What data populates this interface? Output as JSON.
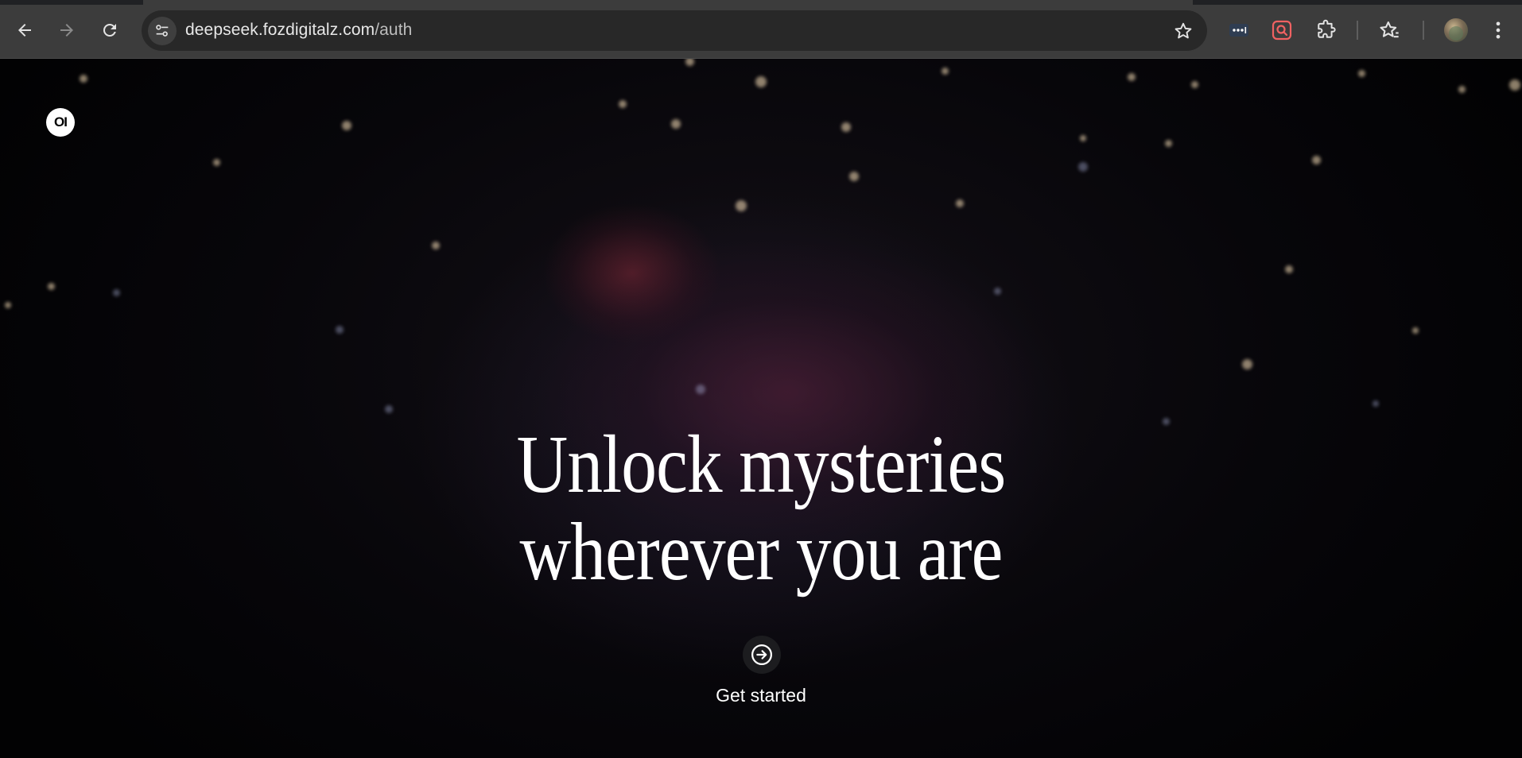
{
  "browser": {
    "url_host": "deepseek.fozdigitalz.com",
    "url_path": "/auth",
    "back_icon": "arrow-left-icon",
    "forward_icon": "arrow-right-icon",
    "reload_icon": "reload-icon",
    "site_info_icon": "tune-icon",
    "bookmark_icon": "star-outline-icon",
    "extensions": [
      "password-manager-icon",
      "screen-search-icon",
      "puzzle-icon"
    ],
    "bookmarks_icon": "star-list-icon",
    "menu_icon": "kebab-menu-icon"
  },
  "page": {
    "logo_text": "OI",
    "headline_line1": "Unlock mysteries",
    "headline_line2": "wherever you are",
    "cta_icon": "arrow-right-circle-icon",
    "cta_label": "Get started"
  },
  "colors": {
    "background": "#000000",
    "text": "#ffffff",
    "nebula": "#581e37"
  }
}
